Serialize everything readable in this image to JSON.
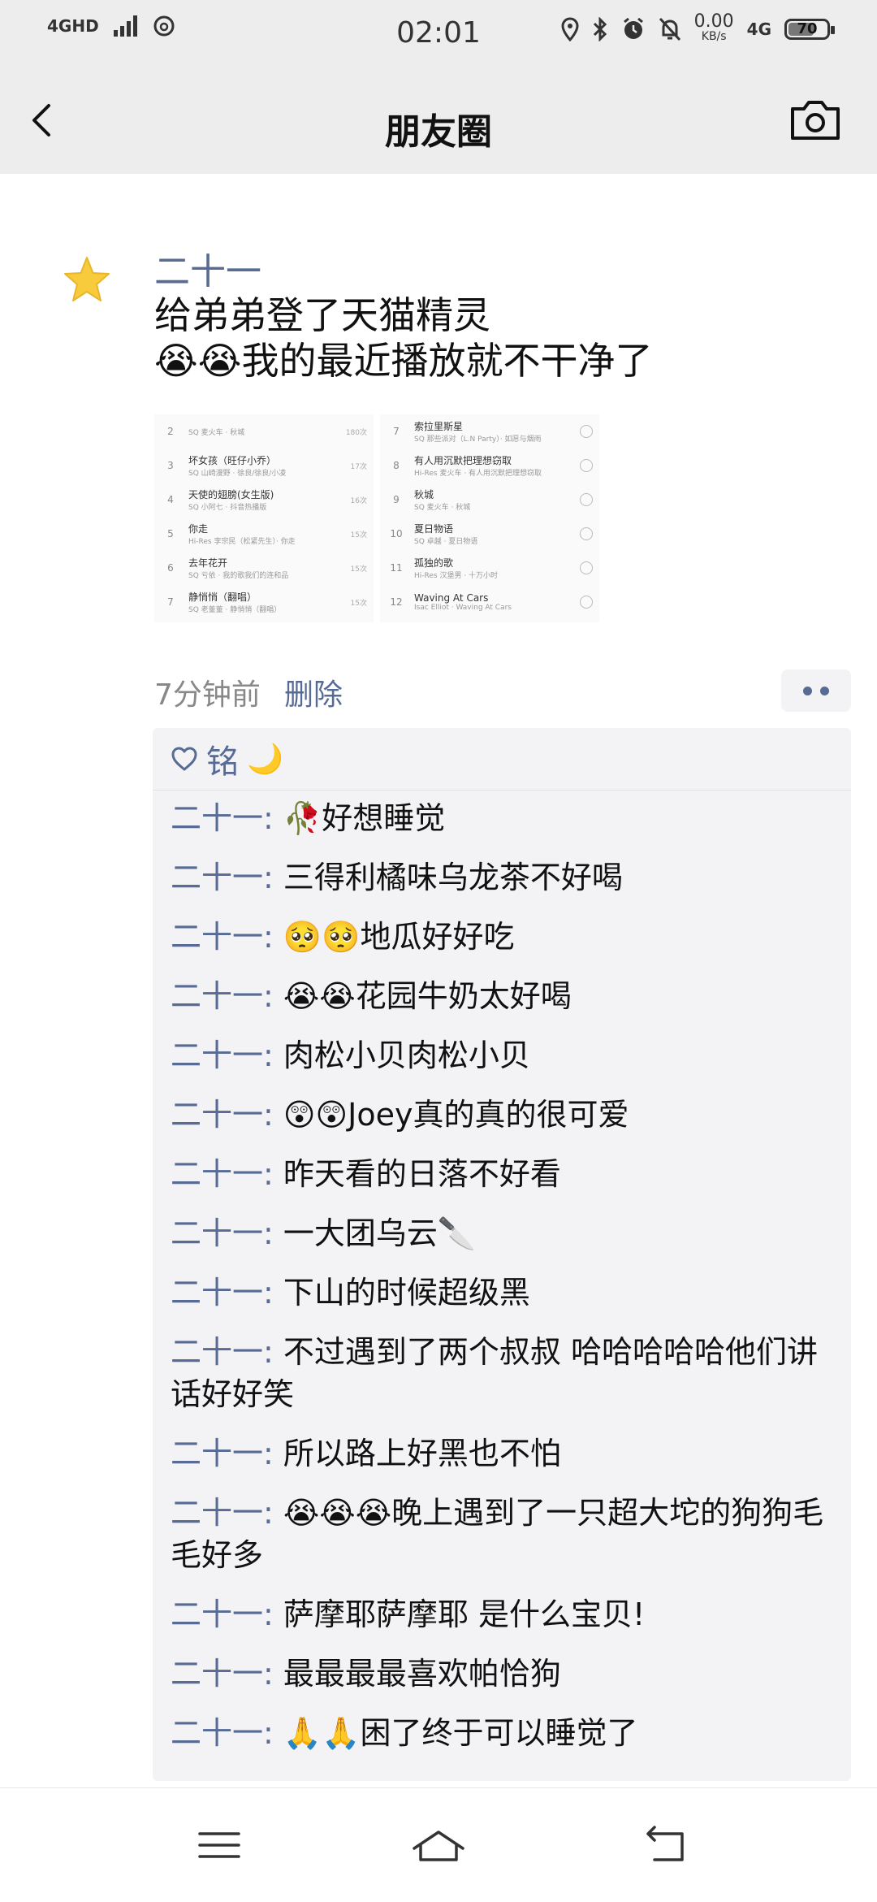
{
  "status_bar": {
    "network": "4GHD",
    "time": "02:01",
    "speed_value": "0.00",
    "speed_unit": "KB/s",
    "cell": "4G",
    "battery": "70",
    "battery_level": 0.7
  },
  "nav": {
    "back_icon": "chevron-left-icon",
    "title": "朋友圈",
    "camera_icon": "camera-icon"
  },
  "post": {
    "avatar_icon": "star-avatar-icon",
    "username": "二十一",
    "text_line1": "给弟弟登了天猫精灵",
    "text_line2": "😭😭我的最近播放就不干净了",
    "time": "7分钟前",
    "delete_label": "删除",
    "more_icon": "more-dots-icon",
    "images": [
      {
        "rows": [
          {
            "idx": "2",
            "title": "",
            "sub": "SQ 麦火车 · 秋城",
            "count": "180次"
          },
          {
            "idx": "3",
            "title": "坏女孩（旺仔小乔）",
            "sub": "SQ 山崎漫野 · 徐良/徐良/小凌",
            "count": "17次"
          },
          {
            "idx": "4",
            "title": "天使的翅膀(女生版)",
            "sub": "SQ 小阿七 · 抖音热播版",
            "count": "16次"
          },
          {
            "idx": "5",
            "title": "你走",
            "sub": "Hi-Res 李宗民（松紧先生）· 你走",
            "count": "15次"
          },
          {
            "idx": "6",
            "title": "去年花开",
            "sub": "SQ 亏依 · 我的歌我们的连和品",
            "count": "15次"
          },
          {
            "idx": "7",
            "title": "静悄悄（翻唱）",
            "sub": "SQ 老董董 · 静悄悄（翻唱）",
            "count": "15次"
          }
        ]
      },
      {
        "rows": [
          {
            "idx": "7",
            "title": "索拉里斯星",
            "sub": "SQ 那些派对（L.N Party）· 如愿与烟雨",
            "count": ""
          },
          {
            "idx": "8",
            "title": "有人用沉默把理想窃取",
            "sub": "Hi-Res 麦火车 · 有人用沉默把理想窃取",
            "count": ""
          },
          {
            "idx": "9",
            "title": "秋城",
            "sub": "SQ 麦火车 · 秋城",
            "count": ""
          },
          {
            "idx": "10",
            "title": "夏日物语",
            "sub": "SQ 卓越 · 夏日物语",
            "count": ""
          },
          {
            "idx": "11",
            "title": "孤独的歌",
            "sub": "Hi-Res 汉堡男 · 十万小时",
            "count": ""
          },
          {
            "idx": "12",
            "title": "Waving At Cars",
            "sub": "Isac Elliot · Waving At Cars",
            "count": ""
          }
        ]
      }
    ],
    "likes": {
      "heart_icon": "heart-outline-icon",
      "name": "铭",
      "emoji": "🌙"
    },
    "comments": [
      {
        "name": "二十一",
        "text": "🥀好想睡觉"
      },
      {
        "name": "二十一",
        "text": "三得利橘味乌龙茶不好喝"
      },
      {
        "name": "二十一",
        "text": "🥺🥺地瓜好好吃"
      },
      {
        "name": "二十一",
        "text": "😭😭花园牛奶太好喝"
      },
      {
        "name": "二十一",
        "text": "肉松小贝肉松小贝"
      },
      {
        "name": "二十一",
        "text": "😲😲Joey真的真的很可爱"
      },
      {
        "name": "二十一",
        "text": "昨天看的日落不好看"
      },
      {
        "name": "二十一",
        "text": "一大团乌云🔪"
      },
      {
        "name": "二十一",
        "text": "下山的时候超级黑"
      },
      {
        "name": "二十一",
        "text": "不过遇到了两个叔叔 哈哈哈哈哈他们讲话好好笑"
      },
      {
        "name": "二十一",
        "text": "所以路上好黑也不怕"
      },
      {
        "name": "二十一",
        "text": "😭😭😭晚上遇到了一只超大坨的狗狗毛毛好多"
      },
      {
        "name": "二十一",
        "text": "萨摩耶萨摩耶 是什么宝贝!"
      },
      {
        "name": "二十一",
        "text": "最最最最喜欢帕恰狗"
      },
      {
        "name": "二十一",
        "text": "🙏🙏困了终于可以睡觉了"
      }
    ]
  },
  "bottom_nav": {
    "menu_icon": "menu-icon",
    "home_icon": "home-icon",
    "back_icon": "back-icon"
  },
  "colors": {
    "link_blue": "#576b95",
    "bar_gray": "#ededed",
    "comment_bg": "#f3f3f5"
  }
}
